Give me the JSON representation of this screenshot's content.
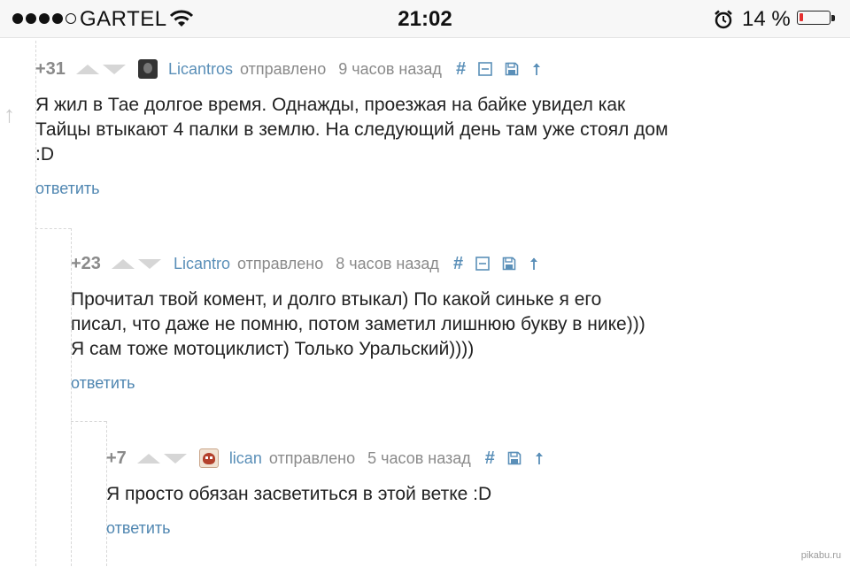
{
  "status_bar": {
    "carrier": "GARTEL",
    "time": "21:02",
    "battery_percent": "14 %",
    "battery_level": 0.14,
    "signal_bars": 4,
    "battery_color": "#e53030"
  },
  "side_icon": "arrow-up-icon",
  "comments": [
    {
      "rating": "+31",
      "author": "Licantros",
      "sent": "отправлено",
      "time": "9 часов назад",
      "text": [
        "Я жил в Тае долгое время. Однажды, проезжая на байке увидел как",
        "Тайцы втыкают 4 палки в землю. На следующий день там уже стоял дом",
        ":D"
      ],
      "reply": "ответить",
      "icons": [
        "hash-icon",
        "collapse-icon",
        "save-icon",
        "arrow-up-icon"
      ]
    },
    {
      "rating": "+23",
      "author": "Licantro",
      "sent": "отправлено",
      "time": "8 часов назад",
      "text": [
        "Прочитал твой комент, и долго втыкал) По какой синьке я его",
        "писал, что даже не помню, потом заметил лишнюю букву в нике)))",
        "Я сам тоже мотоциклист) Только Уральский))))"
      ],
      "reply": "ответить",
      "icons": [
        "hash-icon",
        "collapse-icon",
        "save-icon",
        "arrow-up-icon"
      ]
    },
    {
      "rating": "+7",
      "author": "lican",
      "sent": "отправлено",
      "time": "5 часов назад",
      "text": [
        "Я просто обязан засветиться в этой ветке :D"
      ],
      "reply": "ответить",
      "icons": [
        "hash-icon",
        "save-icon",
        "arrow-up-icon"
      ]
    }
  ],
  "watermark": "pikabu.ru",
  "colors": {
    "link": "#5a8fb8",
    "meta": "#8a8a8a",
    "text": "#222222"
  }
}
